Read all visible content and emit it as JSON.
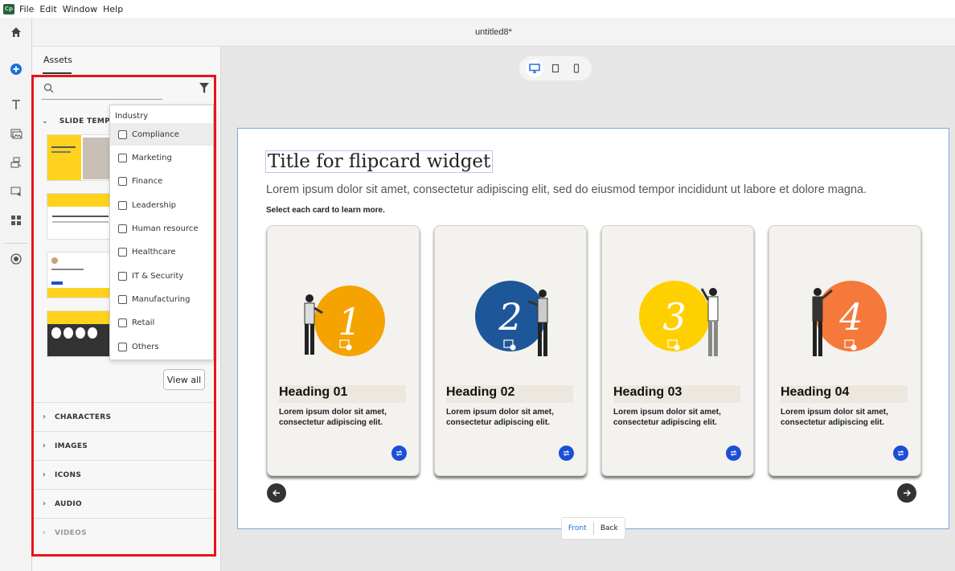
{
  "app": {
    "logo_text": "Cp",
    "menu": [
      "File",
      "Edit",
      "Window",
      "Help"
    ],
    "doc_title": "untitled8*"
  },
  "panel": {
    "tab_label": "Assets",
    "section_title": "SLIDE TEMPL",
    "view_all_label": "View all",
    "accordion": [
      "CHARACTERS",
      "IMAGES",
      "ICONS",
      "AUDIO",
      "VIDEOS"
    ]
  },
  "filter": {
    "title": "Industry",
    "options": [
      "Compliance",
      "Marketing",
      "Finance",
      "Leadership",
      "Human resource",
      "Healthcare",
      "IT & Security",
      "Manufacturing",
      "Retail",
      "Others"
    ]
  },
  "slide": {
    "title": "Title for flipcard widget",
    "body": "Lorem ipsum dolor sit amet, consectetur adipiscing elit, sed do eiusmod tempor incididunt ut labore et dolore magna.",
    "instruction": "Select each card to learn more.",
    "cards": [
      {
        "number": "1",
        "heading": "Heading 01",
        "text": "Lorem ipsum dolor sit amet, consectetur adipiscing elit.",
        "color": "#f5a300"
      },
      {
        "number": "2",
        "heading": "Heading 02",
        "text": "Lorem ipsum dolor sit amet, consectetur adipiscing elit.",
        "color": "#1e5799"
      },
      {
        "number": "3",
        "heading": "Heading 03",
        "text": "Lorem ipsum dolor sit amet, consectetur adipiscing elit.",
        "color": "#ffd000"
      },
      {
        "number": "4",
        "heading": "Heading 04",
        "text": "Lorem ipsum dolor sit amet, consectetur adipiscing elit.",
        "color": "#f4793b"
      }
    ]
  },
  "view_toggle": {
    "front": "Front",
    "back": "Back"
  },
  "colors": {
    "accent": "#1b4fd6",
    "highlight": "#e8141b"
  }
}
